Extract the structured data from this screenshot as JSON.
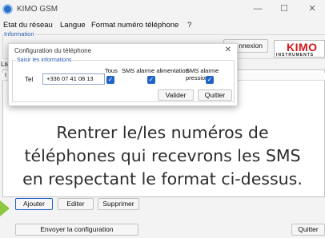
{
  "window": {
    "title": "KIMO GSM",
    "controls": [
      "—",
      "☐",
      "✕"
    ]
  },
  "menu": [
    "Etat du réseau",
    "Langue",
    "Format numéro téléphone",
    "?"
  ],
  "info_group": {
    "legend": "Information",
    "button_partial": "nnexion"
  },
  "logo": {
    "text": "KIMO",
    "sub": "INSTRUMENTS"
  },
  "list": {
    "label": "Lis",
    "header_partial": "I"
  },
  "dialog": {
    "title": "Configuration du téléphone",
    "close": "✕",
    "group_legend": "Saisir les informations",
    "columns": [
      "Tous",
      "SMS alarme alimentation",
      "SMS alarme pression"
    ],
    "tel_label": "Tel",
    "tel_value": "+336 07 41 08 13",
    "checks": {
      "tous": true,
      "alimentation": true,
      "pression": true
    },
    "validate": "Valider",
    "quit": "Quitter"
  },
  "overlay": {
    "line1": "Rentrer le/les numéros de",
    "line2": "téléphones qui recevrons les SMS",
    "line3": "en respectant le format ci-dessus."
  },
  "buttons": {
    "add": "Ajouter",
    "edit": "Editer",
    "delete": "Supprimer",
    "send": "Envoyer la configuration",
    "quit": "Quitter"
  },
  "colors": {
    "accent": "#1f63c9",
    "brand": "#d6141b",
    "marker": "#8dc63f"
  }
}
